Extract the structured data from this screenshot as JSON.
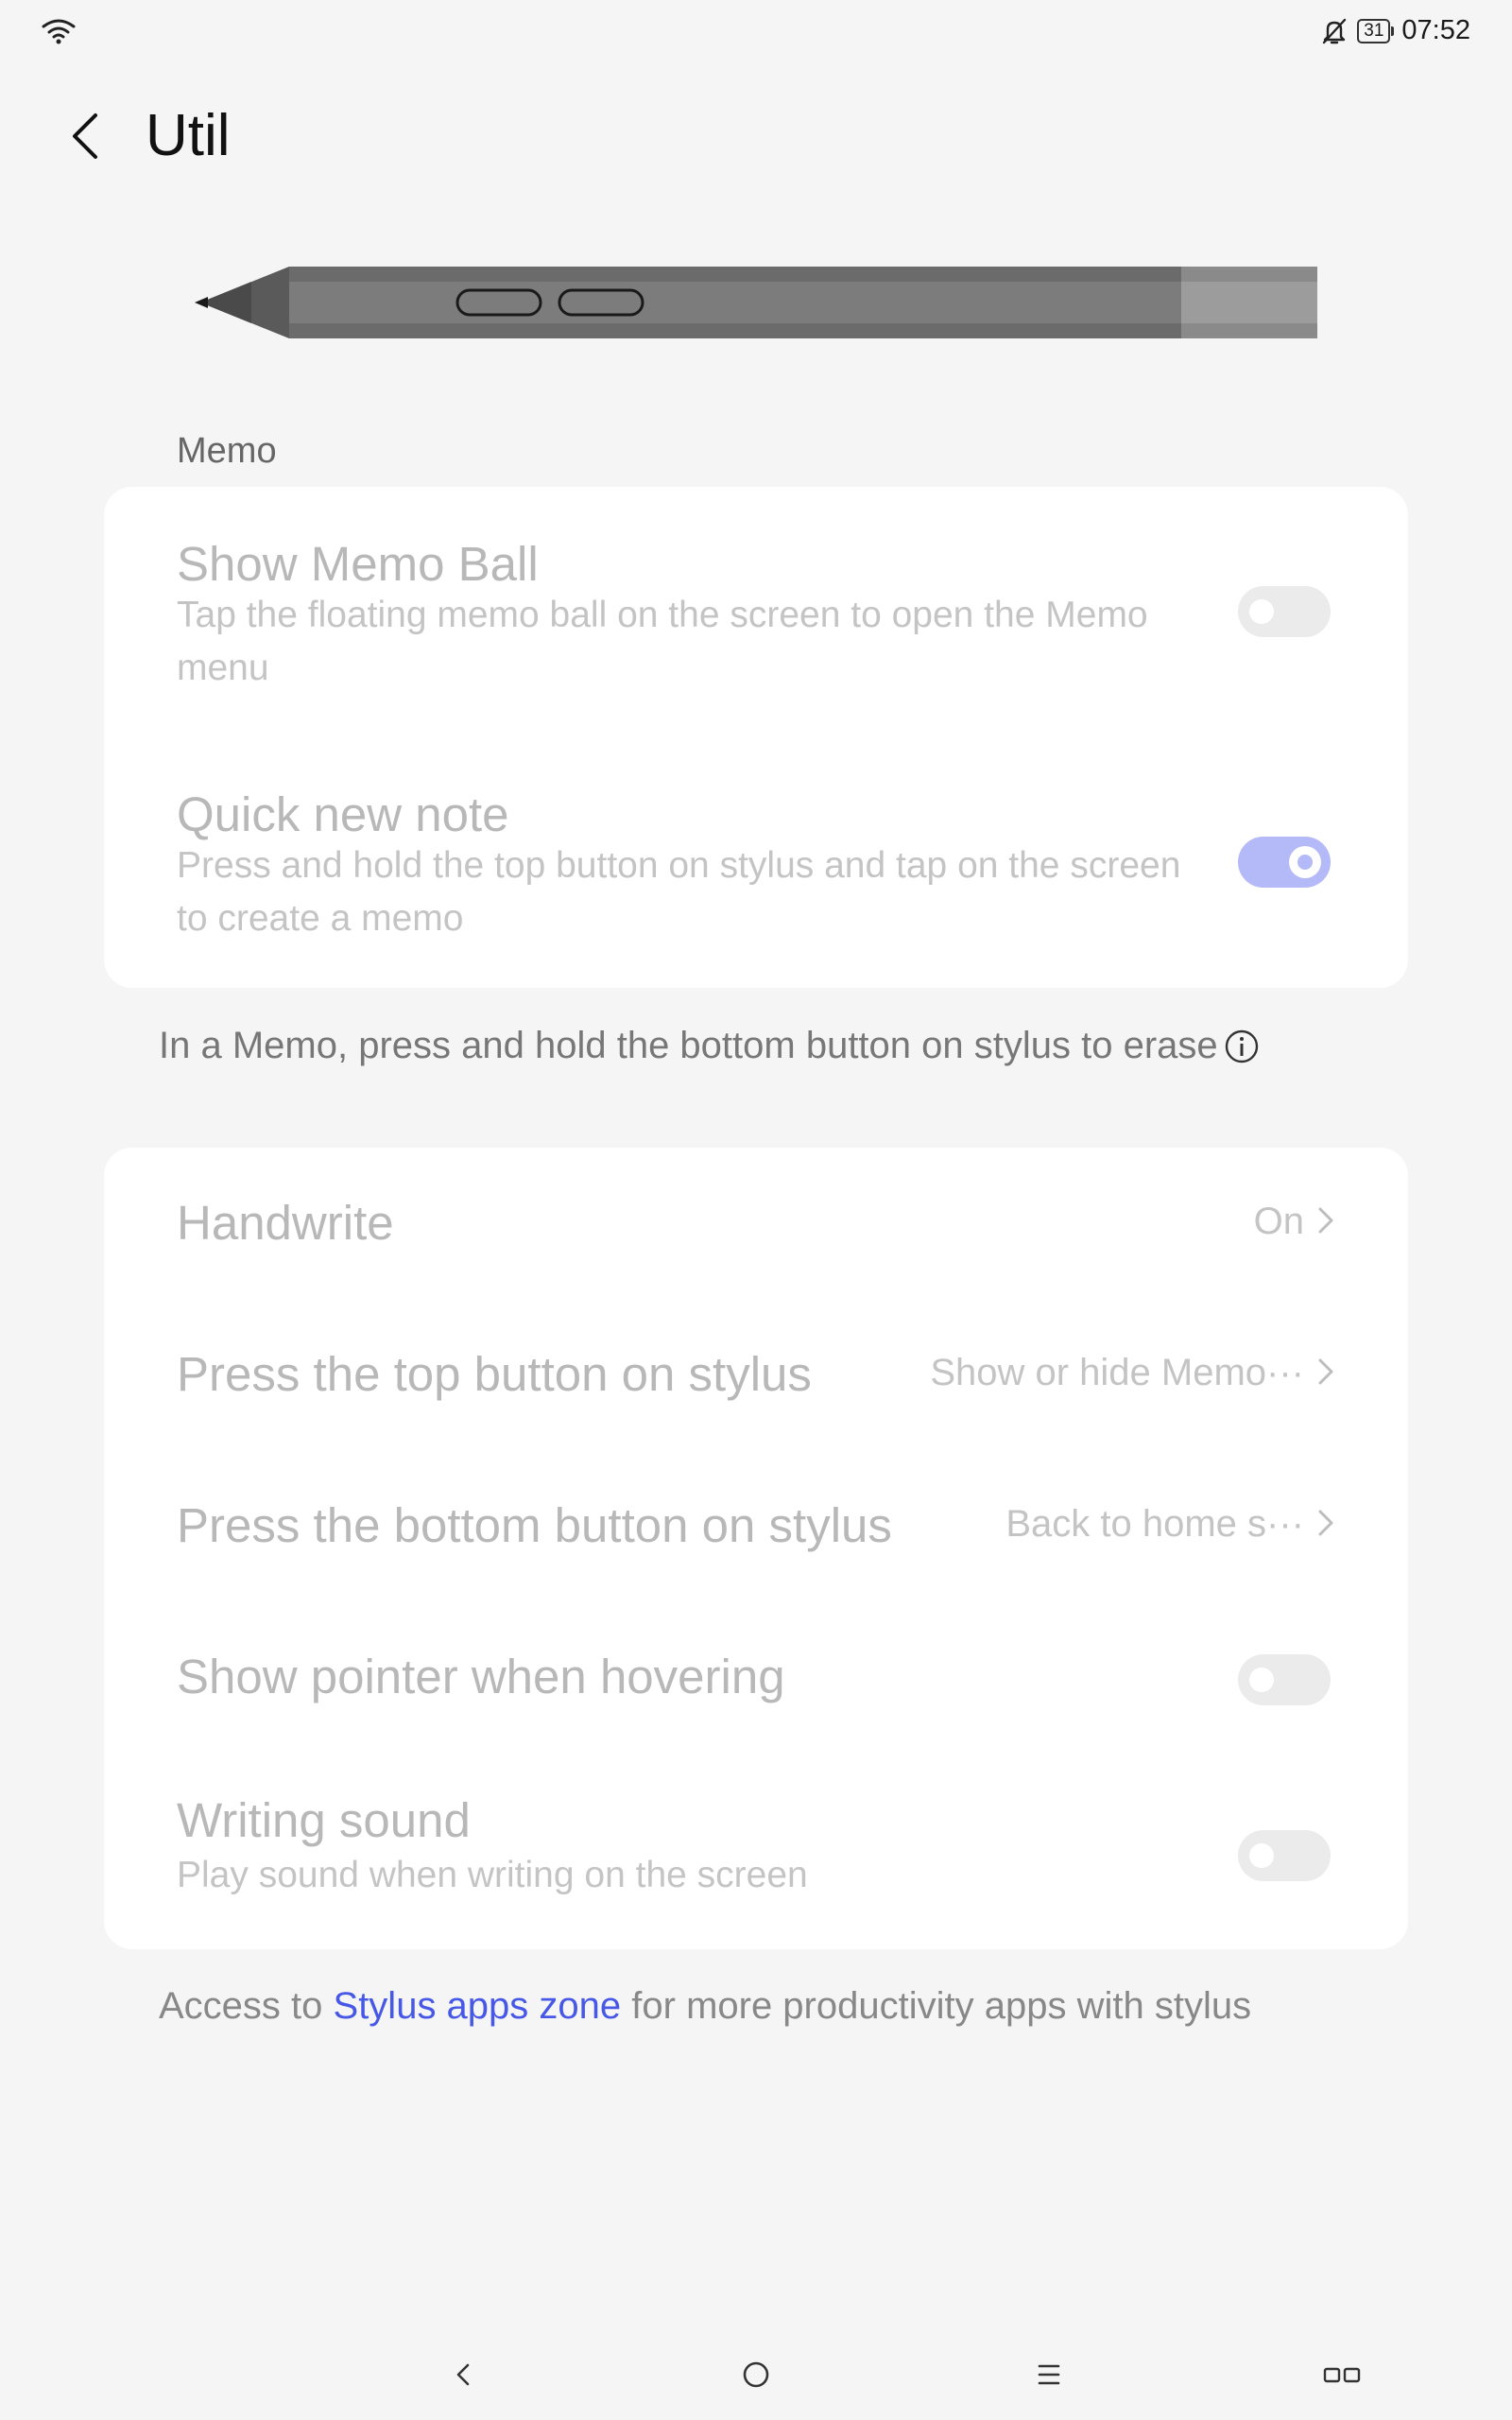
{
  "status_bar": {
    "time": "07:52",
    "battery": "31",
    "icons": [
      "wifi-icon",
      "bell-off-icon",
      "battery-icon"
    ]
  },
  "header": {
    "title": "Util",
    "back_icon": "back-arrow-icon"
  },
  "illustration": "stylus-icon",
  "memo_section": {
    "label": "Memo",
    "items": [
      {
        "title": "Show Memo Ball",
        "description": "Tap the floating memo ball on the screen to open the Memo menu",
        "toggle_on": false
      },
      {
        "title": "Quick new note",
        "description": "Press and hold the top button on stylus and tap on the screen to create a memo",
        "toggle_on": true
      }
    ],
    "note": "In a Memo, press and hold the bottom button on stylus to erase"
  },
  "stylus_section": {
    "items": [
      {
        "title": "Handwrite",
        "value": "On",
        "type": "link"
      },
      {
        "title": "Press the top button on stylus",
        "value": "Show or hide Memo···",
        "type": "link"
      },
      {
        "title": "Press the bottom button on stylus",
        "value": "Back to home s···",
        "type": "link"
      },
      {
        "title": "Show pointer when hovering",
        "type": "toggle",
        "toggle_on": false
      },
      {
        "title": "Writing sound",
        "description": "Play sound when writing on the screen",
        "type": "toggle",
        "toggle_on": false
      }
    ]
  },
  "footer": {
    "prefix": "Access to ",
    "link": "Stylus apps zone",
    "suffix": " for more productivity apps with stylus"
  },
  "nav_bar": {
    "buttons": [
      "nav-back-icon",
      "nav-home-icon",
      "nav-menu-icon",
      "nav-recents-icon"
    ]
  },
  "colors": {
    "background": "#f5f5f5",
    "card": "#ffffff",
    "accent": "#4758e6",
    "toggle_on": "#b4b9f7"
  }
}
